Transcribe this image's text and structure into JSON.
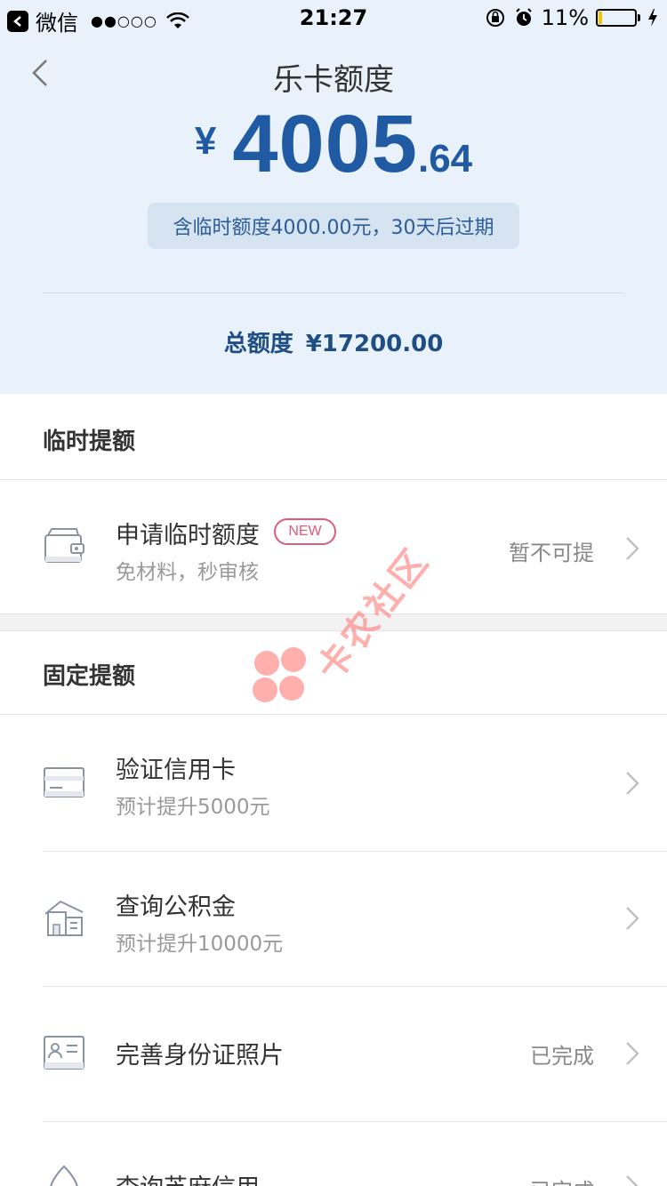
{
  "status_bar": {
    "app_name": "微信",
    "signal": "●●○○○",
    "time": "21:27",
    "battery_pct": "11%",
    "battery_level": 0.11
  },
  "header": {
    "title": "乐卡额度",
    "currency_symbol": "¥",
    "amount_int": "4005",
    "amount_dec": ".64",
    "temp_note": "含临时额度4000.00元，30天后过期",
    "total_label": "总额度",
    "total_value": "¥17200.00"
  },
  "temp_section": {
    "title": "临时提额",
    "item": {
      "title": "申请临时额度",
      "badge": "NEW",
      "subtitle": "免材料，秒审核",
      "status": "暂不可提",
      "icon": "wallet-icon"
    }
  },
  "fixed_section": {
    "title": "固定提额",
    "items": [
      {
        "title": "验证信用卡",
        "subtitle": "预计提升5000元",
        "status": "",
        "icon": "credit-card-icon"
      },
      {
        "title": "查询公积金",
        "subtitle": "预计提升10000元",
        "status": "",
        "icon": "building-icon"
      },
      {
        "title": "完善身份证照片",
        "subtitle": "",
        "status": "已完成",
        "icon": "id-card-icon"
      },
      {
        "title": "查询芝麻信用",
        "subtitle": "",
        "status": "已完成",
        "icon": "sesame-icon"
      }
    ]
  },
  "watermark": "卡农社区",
  "colors": {
    "header_bg": "#e9f2fa",
    "accent_blue": "#1f5aa2",
    "badge_red": "#e05b7a"
  }
}
